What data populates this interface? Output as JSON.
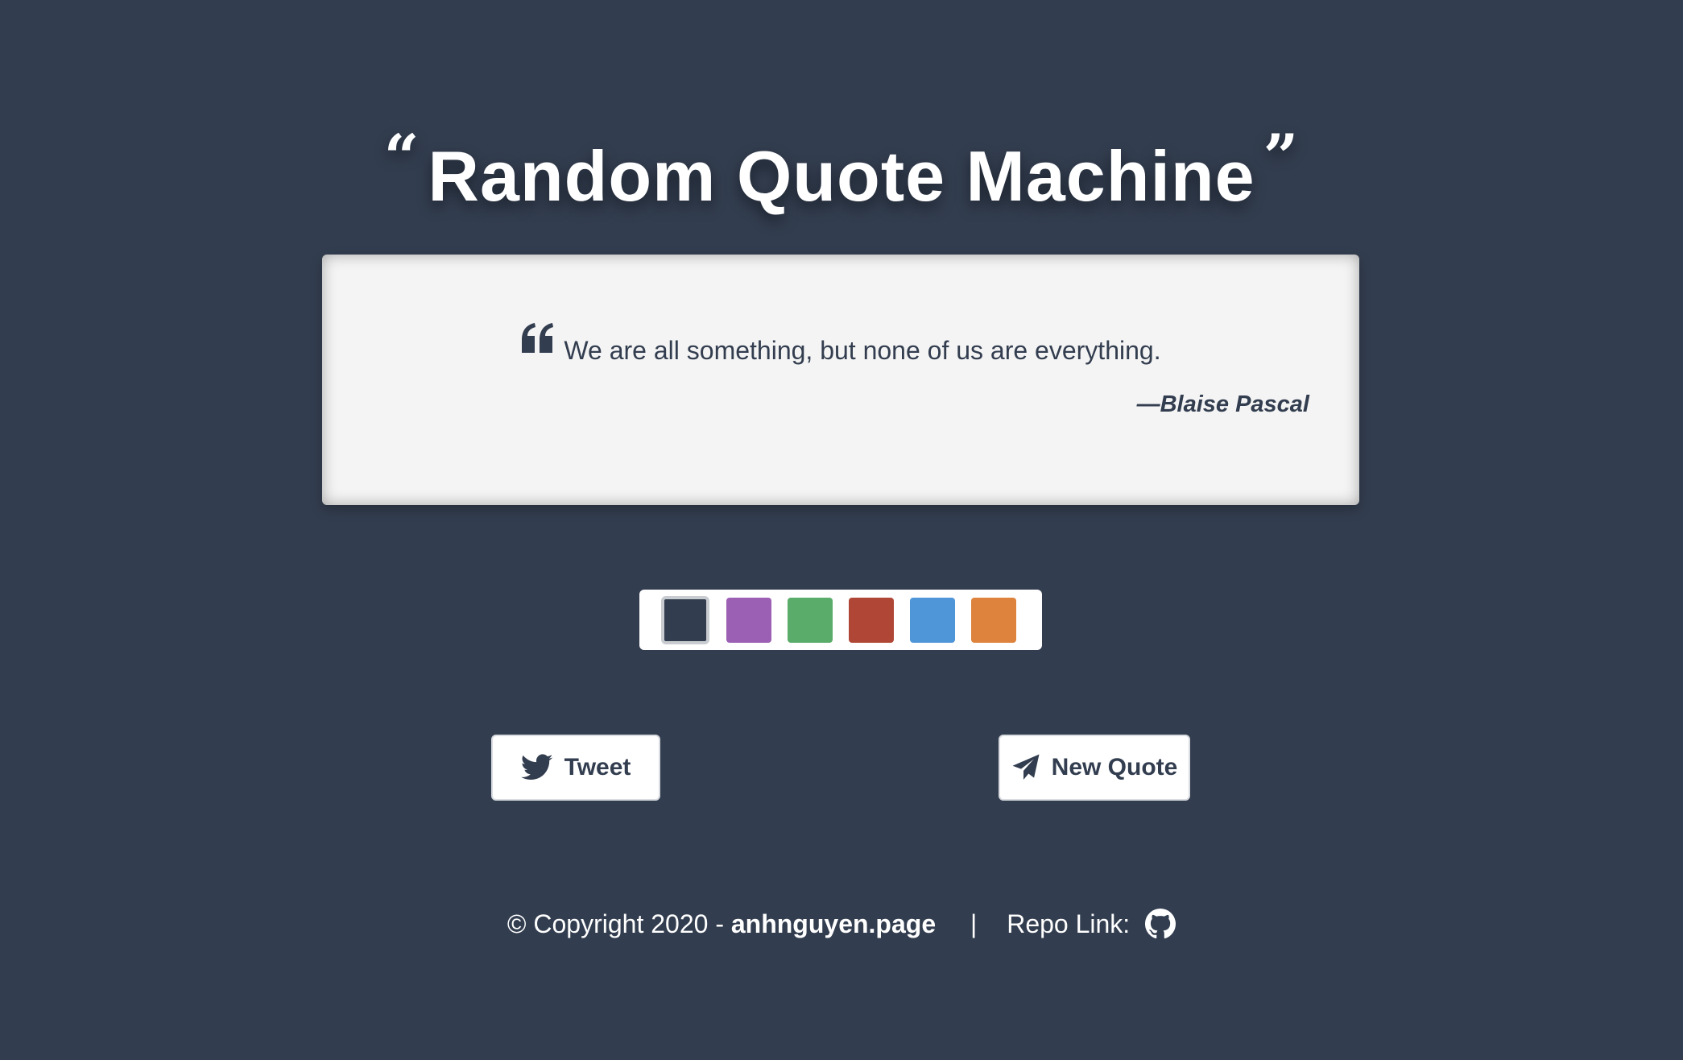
{
  "title": {
    "open_quote": "“",
    "text": "Random Quote Machine",
    "close_quote": "”"
  },
  "quote": {
    "icon": "quote-left-icon",
    "text": "We are all something, but none of us are everything.",
    "author": "—Blaise Pascal"
  },
  "palette": {
    "selected_index": 0,
    "colors": [
      "#323d4f",
      "#9b5fb4",
      "#5aac6a",
      "#b04636",
      "#4f96d8",
      "#dd833d"
    ]
  },
  "buttons": {
    "tweet": {
      "label": "Tweet",
      "icon": "twitter-icon"
    },
    "new_quote": {
      "label": "New Quote",
      "icon": "paper-plane-icon"
    }
  },
  "footer": {
    "copyright": "© Copyright 2020 -",
    "site_link": "anhnguyen.page",
    "separator": "|",
    "repo_label": "Repo Link:",
    "repo_icon": "github-icon"
  }
}
